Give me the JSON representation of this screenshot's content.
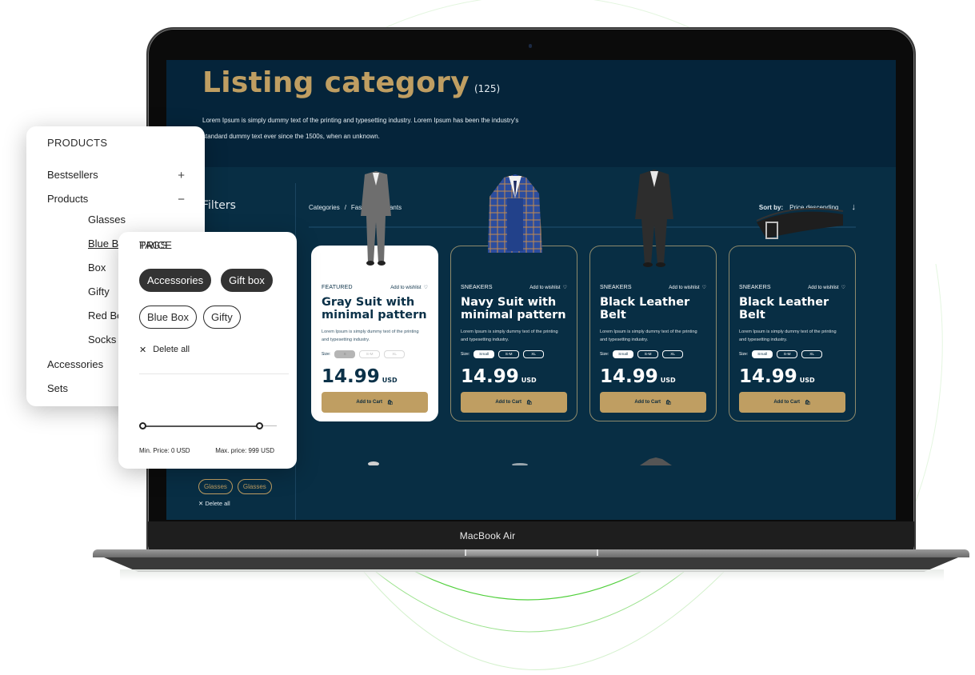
{
  "device": {
    "label": "MacBook Air"
  },
  "hero": {
    "title": "Listing category",
    "count": "(125)",
    "description": "Lorem Ipsum is simply dummy text of the printing and typesetting industry. Lorem Ipsum has been the industry's standard dummy text ever since the 1500s, when an unknown."
  },
  "filters": {
    "title": "Filters",
    "active_chips": [
      "Glasses",
      "Glasses"
    ],
    "delete_all": "Delete all"
  },
  "breadcrumb": [
    "Categories",
    "/",
    "Fashion",
    "/",
    "Pants"
  ],
  "sort": {
    "label": "Sort by:",
    "value": "Price descending",
    "direction_icon": "arrow-down"
  },
  "products": [
    {
      "tag": "FEATURED",
      "wishlist": "Add to wishlist",
      "title": "Gray Suit with minimal pattern",
      "description": "Lorem Ipsum is simply dummy text of the printing and typesetting industry.",
      "size_label": "Size:",
      "sizes": [
        "S",
        "S-M",
        "XL"
      ],
      "selected_size": "S",
      "price": "14.99",
      "currency": "USD",
      "cta": "Add to Cart",
      "featured": true,
      "image": "gray-suit"
    },
    {
      "tag": "SNEAKERS",
      "wishlist": "Add to wishlist",
      "title": "Navy Suit with minimal pattern",
      "description": "Lorem Ipsum is simply dummy text of the printing and typesetting industry.",
      "size_label": "Size:",
      "sizes": [
        "Small",
        "S-M",
        "XL"
      ],
      "selected_size": "Small",
      "price": "14.99",
      "currency": "USD",
      "cta": "Add to Cart",
      "featured": false,
      "image": "navy-plaid-suit"
    },
    {
      "tag": "SNEAKERS",
      "wishlist": "Add to wishlist",
      "title": "Black Leather Belt",
      "description": "Lorem Ipsum is simply dummy text of the printing and typesetting industry.",
      "size_label": "Size:",
      "sizes": [
        "Small",
        "S-M",
        "XL"
      ],
      "selected_size": "Small",
      "price": "14.99",
      "currency": "USD",
      "cta": "Add to Cart",
      "featured": false,
      "image": "black-suit"
    },
    {
      "tag": "SNEAKERS",
      "wishlist": "Add to wishlist",
      "title": "Black Leather Belt",
      "description": "Lorem Ipsum is simply dummy text of the printing and typesetting industry.",
      "size_label": "Size:",
      "sizes": [
        "Small",
        "S-M",
        "XL"
      ],
      "selected_size": "Small",
      "price": "14.99",
      "currency": "USD",
      "cta": "Add to Cart",
      "featured": false,
      "image": "leather-belt"
    }
  ],
  "products_panel": {
    "heading": "PRODUCTS",
    "items": [
      {
        "label": "Bestsellers",
        "toggle": "+"
      },
      {
        "label": "Products",
        "toggle": "−"
      }
    ],
    "subitems": [
      "Glasses",
      "Blue Box",
      "Box",
      "Gifty",
      "Red Box",
      "Socks"
    ],
    "more_items": [
      "Accessories",
      "Sets"
    ]
  },
  "tags_panel": {
    "heading": "TAGS",
    "selected_tags": [
      "Accessories",
      "Gift box"
    ],
    "unselected_tags": [
      "Blue Box",
      "Gifty"
    ],
    "delete_all": "Delete all",
    "price_heading": "PRICE",
    "min_price_label": "Min. Price: 0 USD",
    "max_price_label": "Max. price: 999 USD",
    "range_min": 0,
    "range_max": 999,
    "slider_low_fraction": 0.0,
    "slider_high_fraction": 0.85
  },
  "colors": {
    "accent_gold": "#bf9e62",
    "screen_bg": "#082e44",
    "hero_bg": "#05243a",
    "arc_green": "#4fcf3a"
  }
}
